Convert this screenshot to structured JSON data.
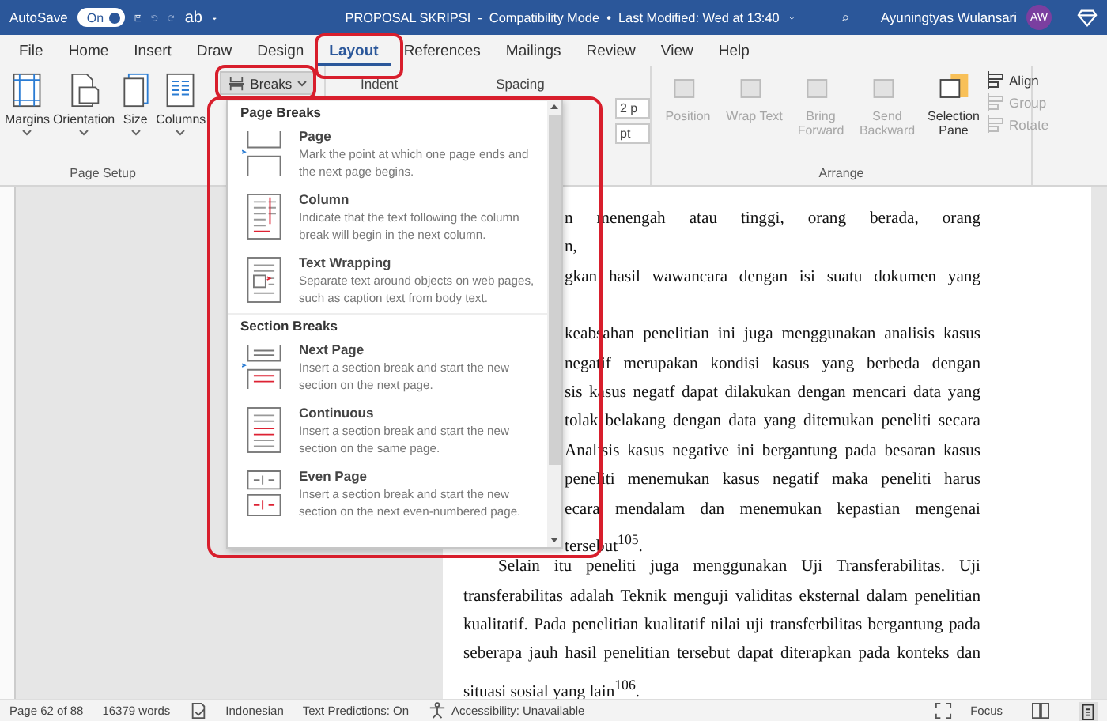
{
  "title_bar": {
    "autosave_label": "AutoSave",
    "autosave": {
      "on": true,
      "label": "On"
    },
    "quick_text": "ab",
    "document_title": "PROPOSAL SKRIPSI  -  Compatibility Mode  •  Last Modified: Wed at 13:40",
    "user_name": "Ayuningtyas Wulansari",
    "avatar_initials": "AW"
  },
  "menu_tabs": [
    {
      "label": "File",
      "selected": false
    },
    {
      "label": "Home",
      "selected": false
    },
    {
      "label": "Insert",
      "selected": false
    },
    {
      "label": "Draw",
      "selected": false
    },
    {
      "label": "Design",
      "selected": false
    },
    {
      "label": "Layout",
      "selected": true
    },
    {
      "label": "References",
      "selected": false
    },
    {
      "label": "Mailings",
      "selected": false
    },
    {
      "label": "Review",
      "selected": false
    },
    {
      "label": "View",
      "selected": false
    },
    {
      "label": "Help",
      "selected": false
    }
  ],
  "ribbon": {
    "page_setup": {
      "buttons": [
        {
          "kind": "margins",
          "label": "Margins"
        },
        {
          "kind": "orientation",
          "label": "Orientation"
        },
        {
          "kind": "size",
          "label": "Size"
        },
        {
          "kind": "columns",
          "label": "Columns"
        }
      ],
      "breaks_button": "Breaks",
      "label": "Page Setup"
    },
    "paragraph": {
      "indent_label": "Indent",
      "spacing_label": "Spacing",
      "spacing_fields": [
        "2 p",
        "pt"
      ]
    },
    "arrange": {
      "buttons": [
        {
          "label": "Position",
          "disabled": true
        },
        {
          "label": "Wrap Text",
          "disabled": true
        },
        {
          "label": "Bring Forward",
          "disabled": true
        },
        {
          "label": "Send Backward",
          "disabled": true
        },
        {
          "label": "Selection Pane",
          "disabled": false
        }
      ],
      "small_buttons": [
        {
          "label": "Align",
          "disabled": false
        },
        {
          "label": "Group",
          "disabled": true
        },
        {
          "label": "Rotate",
          "disabled": true
        }
      ],
      "label": "Arrange"
    }
  },
  "breaks_menu": {
    "sections": [
      {
        "heading": "Page Breaks",
        "items": [
          {
            "kind": "page",
            "title": "Page",
            "description": "Mark the point at which one page ends and the next page begins."
          },
          {
            "kind": "column",
            "title": "Column",
            "description": "Indicate that the text following the column break will begin in the next column."
          },
          {
            "kind": "text-wrapping",
            "title": "Text Wrapping",
            "description": "Separate text around objects on web pages, such as caption text from body text."
          }
        ]
      },
      {
        "heading": "Section Breaks",
        "items": [
          {
            "kind": "next-page",
            "title": "Next Page",
            "description": "Insert a section break and start the new section on the next page."
          },
          {
            "kind": "continuous",
            "title": "Continuous",
            "description": "Insert a section break and start the new section on the same page."
          },
          {
            "kind": "even-page",
            "title": "Even Page",
            "description": "Insert a section break and start the new section on the next even-numbered page."
          }
        ]
      }
    ]
  },
  "document": {
    "covered_paragraphs": [
      {
        "lines": [
          "n menengah atau tinggi, orang berada, orang",
          "n,",
          "gkan hasil wawancara dengan isi suatu dokumen yang"
        ]
      },
      {
        "lines": [
          "keabsahan penelitian ini juga menggunakan analisis kasus",
          "negatif merupakan kondisi kasus yang berbeda dengan",
          "sis kasus negatf dapat dilakukan dengan mencari data yang",
          "tolak belakang dengan data yang ditemukan peneliti secara",
          "Analisis kasus negative ini bergantung pada besaran kasus",
          "peneliti menemukan kasus negatif maka peneliti harus",
          "ecara mendalam dan menemukan kepastian mengenai",
          "tersebut$^{105}$."
        ]
      }
    ],
    "lines": [
      {
        "text": "Selain itu peneliti juga menggunakan Uji Transferabilitas. Uji",
        "justified": true,
        "indent": true
      },
      {
        "text": "transferabilitas adalah Teknik menguji validitas eksternal dalam penelitian",
        "justified": true,
        "indent": false
      },
      {
        "text": "kualitatif. Pada penelitian kualitatif nilai uji transferbilitas bergantung pada",
        "justified": true,
        "indent": false
      },
      {
        "text": "seberapa jauh hasil penelitian tersebut dapat diterapkan pada konteks dan",
        "justified": true,
        "indent": false
      },
      {
        "text": "situasi sosial yang lain$^{106}$.",
        "justified": false,
        "indent": false
      }
    ]
  },
  "status_bar": {
    "page": "Page 62 of 88",
    "words": "16379 words",
    "language": "Indonesian",
    "text_predictions": "Text Predictions: On",
    "accessibility": "Accessibility: Unavailable",
    "focus": "Focus"
  }
}
